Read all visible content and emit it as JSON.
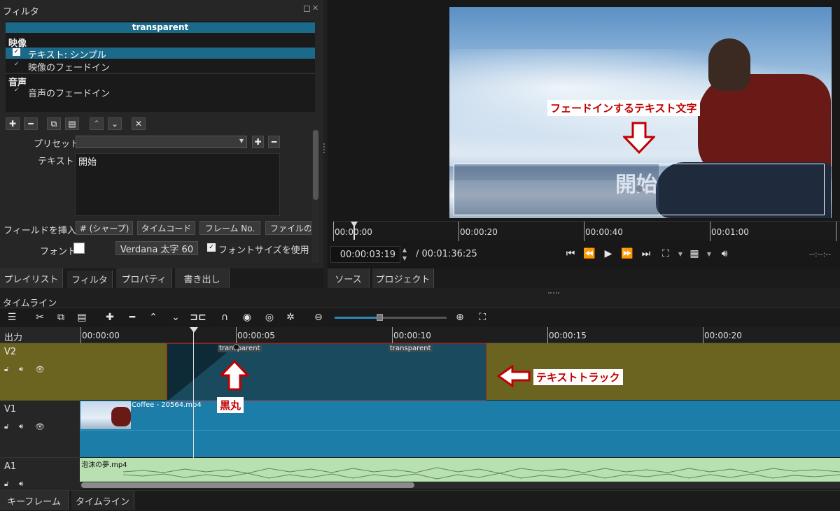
{
  "filter_panel": {
    "title": "フィルタ",
    "clip_name": "transparent",
    "sections": [
      {
        "heading": "映像",
        "items": [
          {
            "check": "✓",
            "label": "テキスト: シンプル",
            "selected": true
          },
          {
            "check": "✓",
            "label": "映像のフェードイン",
            "selected": false
          }
        ]
      },
      {
        "heading": "音声",
        "items": [
          {
            "check": "✓",
            "label": "音声のフェードイン",
            "selected": false
          }
        ]
      }
    ],
    "toolbar": [
      "plus-icon",
      "minus-icon",
      "copy-icon",
      "paste-icon",
      "up-icon",
      "down-icon",
      "close-icon"
    ],
    "preset_label": "プリセット",
    "preset_value": "",
    "text_label": "テキスト",
    "text_value": "開始",
    "insert_field_label": "フィールドを挿入",
    "insert_buttons": [
      "# (シャープ)",
      "タイムコード",
      "フレーム No.",
      "ファイルの"
    ],
    "font_label": "フォント",
    "font_button": "Verdana 太字 60",
    "font_size_check": "✓",
    "font_size_label": "フォントサイズを使用"
  },
  "left_tabs": [
    "プレイリスト",
    "フィルタ",
    "プロパティ",
    "書き出し"
  ],
  "preview": {
    "overlay_text": "開始",
    "callout_text": "フェードインするテキスト文字",
    "ruler_labels": [
      "00:00:00",
      "00:00:20",
      "00:00:40",
      "00:01:00"
    ],
    "timecode": "00:00:03:19",
    "duration": "/ 00:01:36:25",
    "in_out": "--:--:--",
    "colors": {
      "sky": "#a9c6e4",
      "sweater": "#7b1a1a"
    }
  },
  "player_tabs": [
    "ソース",
    "プロジェクト"
  ],
  "timeline": {
    "title": "タイムライン",
    "output_label": "出力",
    "ruler": [
      "00:00:00",
      "00:00:05",
      "00:00:10",
      "00:00:15",
      "00:00:20"
    ],
    "tracks": {
      "v2": {
        "name": "V2",
        "clip_label_1": "transparent",
        "clip_label_2": "transparent",
        "callout": "テキストトラック",
        "dot_callout": "黒丸"
      },
      "v1": {
        "name": "V1",
        "clip_label": "Coffee - 20564.mp4"
      },
      "a1": {
        "name": "A1",
        "clip_label": "泡沫の夢.mp4"
      }
    },
    "colors": {
      "olive": "#6b6320",
      "clip_blue": "#1c7ea8",
      "audio_green": "#b8e0b0"
    }
  },
  "bottom_tabs": [
    "キーフレーム",
    "タイムライン"
  ]
}
